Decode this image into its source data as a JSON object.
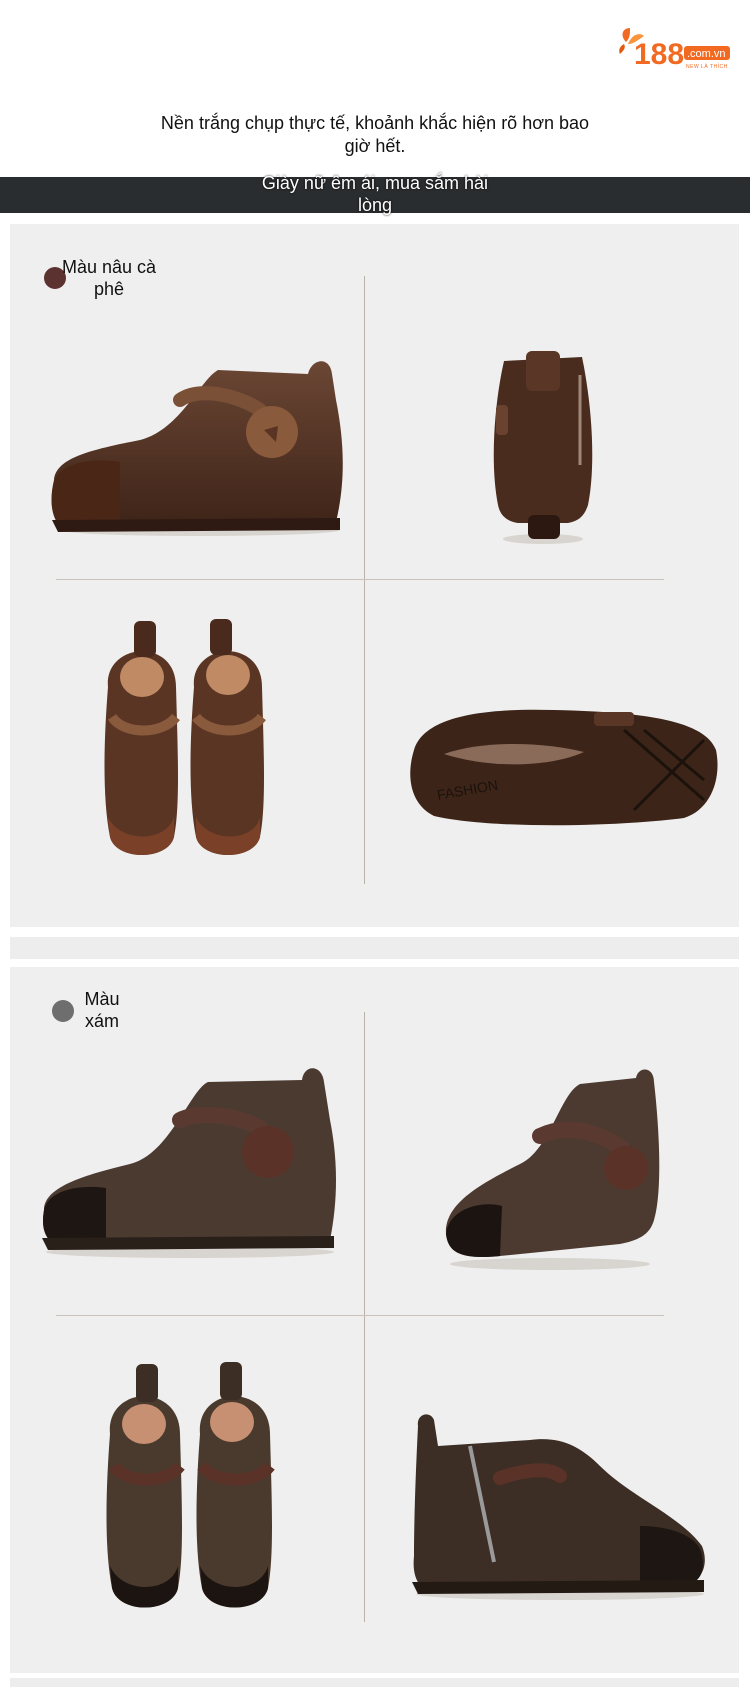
{
  "brand": {
    "logo_text": "188",
    "domain": ".com.vn",
    "tagline": "NEW LÀ THÍCH",
    "accent_color": "#f26a21"
  },
  "header": {
    "headline": "Nền trắng chụp thực tế, khoảnh khắc hiện rõ hơn bao giờ hết.",
    "subtitle": "Giày nữ êm ái, mua sắm hài lòng"
  },
  "variants": [
    {
      "color_name": "Màu nâu cà phê",
      "swatch_color": "#5c3230",
      "views": [
        "side-view",
        "back-view",
        "top-view-pair",
        "sole-view"
      ]
    },
    {
      "color_name": "Màu xám",
      "swatch_color": "#6e6e6e",
      "views": [
        "side-view",
        "front-angle-view",
        "top-view-pair",
        "inner-side-view"
      ]
    }
  ]
}
